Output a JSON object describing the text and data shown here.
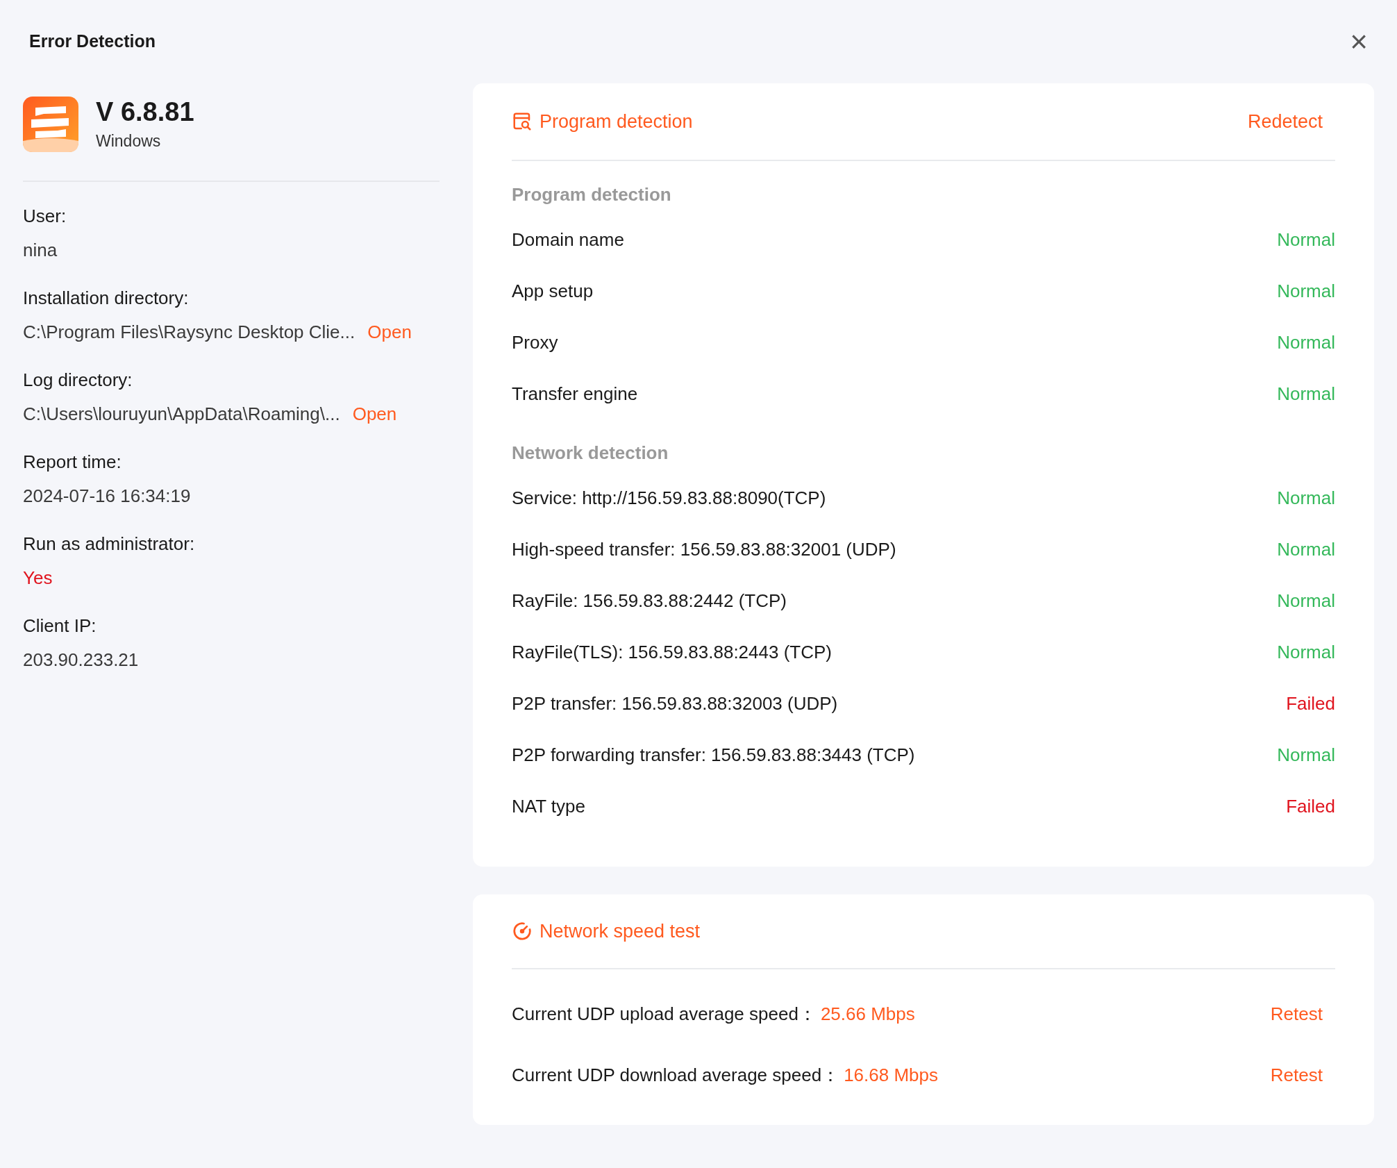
{
  "window": {
    "title": "Error Detection",
    "close": "×"
  },
  "app": {
    "version": "V 6.8.81",
    "platform": "Windows"
  },
  "info": [
    {
      "label": "User:",
      "value": "nina",
      "kind": "plain"
    },
    {
      "label": "Installation directory:",
      "value": "C:\\Program Files\\Raysync Desktop Clie...",
      "kind": "path",
      "action": "Open"
    },
    {
      "label": "Log directory:",
      "value": "C:\\Users\\louruyun\\AppData\\Roaming\\...",
      "kind": "path",
      "action": "Open"
    },
    {
      "label": "Report time:",
      "value": "2024-07-16 16:34:19",
      "kind": "plain"
    },
    {
      "label": "Run as administrator:",
      "value": "Yes",
      "kind": "alert"
    },
    {
      "label": "Client IP:",
      "value": "203.90.233.21",
      "kind": "plain"
    }
  ],
  "detection": {
    "title": "Program detection",
    "action": "Redetect",
    "sections": [
      {
        "heading": "Program detection",
        "items": [
          {
            "label": "Domain name",
            "result": "Normal",
            "failed": false
          },
          {
            "label": "App setup",
            "result": "Normal",
            "failed": false
          },
          {
            "label": "Proxy",
            "result": "Normal",
            "failed": false
          },
          {
            "label": "Transfer engine",
            "result": "Normal",
            "failed": false
          }
        ]
      },
      {
        "heading": "Network detection",
        "items": [
          {
            "label": "Service: http://156.59.83.88:8090(TCP)",
            "result": "Normal",
            "failed": false
          },
          {
            "label": "High-speed transfer: 156.59.83.88:32001 (UDP)",
            "result": "Normal",
            "failed": false
          },
          {
            "label": "RayFile: 156.59.83.88:2442 (TCP)",
            "result": "Normal",
            "failed": false
          },
          {
            "label": "RayFile(TLS): 156.59.83.88:2443 (TCP)",
            "result": "Normal",
            "failed": false
          },
          {
            "label": "P2P transfer: 156.59.83.88:32003 (UDP)",
            "result": "Failed",
            "failed": true
          },
          {
            "label": "P2P forwarding transfer: 156.59.83.88:3443 (TCP)",
            "result": "Normal",
            "failed": false
          },
          {
            "label": "NAT type",
            "result": "Failed",
            "failed": true
          }
        ]
      }
    ]
  },
  "speed_test": {
    "title": "Network speed test",
    "rows": [
      {
        "label": "Current UDP upload average speed：",
        "value": "25.66 Mbps",
        "action": "Retest"
      },
      {
        "label": "Current UDP download average speed：",
        "value": "16.68 Mbps",
        "action": "Retest"
      }
    ]
  }
}
